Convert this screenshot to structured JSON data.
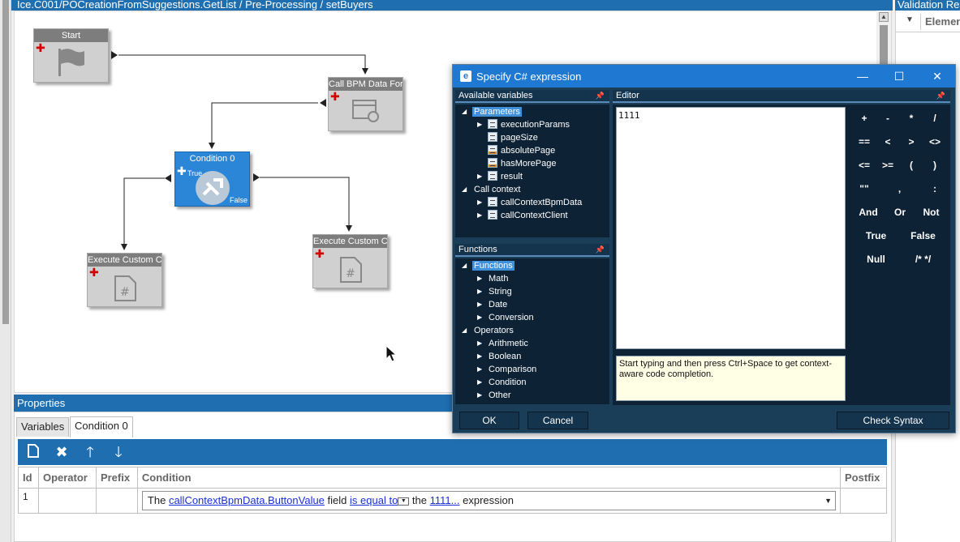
{
  "workflow": {
    "path": "Ice.C001/POCreationFromSuggestions.GetList / Pre-Processing / setBuyers",
    "nodes": {
      "start": "Start",
      "call_bpm": "Call BPM Data Form",
      "condition": "Condition 0",
      "exec1": "Execute Custom Code",
      "exec2": "Execute Custom Code"
    },
    "true_label": "True",
    "false_label": "False"
  },
  "validation": {
    "title": "Validation Results",
    "col": "Element"
  },
  "properties": {
    "title": "Properties",
    "tabs": [
      "Variables",
      "Condition 0"
    ],
    "columns": [
      "Id",
      "Operator",
      "Prefix",
      "Condition",
      "Postfix"
    ],
    "row": {
      "id": "1",
      "t1": "The",
      "field": "callContextBpmData.ButtonValue",
      "t2": "field",
      "op": "is equal to",
      "t3": "the",
      "expr": "1111...",
      "t4": "expression"
    }
  },
  "dialog": {
    "title": "Specify C# expression",
    "available_vars": "Available variables",
    "editor_label": "Editor",
    "parameters": "Parameters",
    "params": [
      "executionParams",
      "pageSize",
      "absolutePage",
      "hasMorePage",
      "result"
    ],
    "call_context": "Call context",
    "ctx": [
      "callContextBpmData",
      "callContextClient"
    ],
    "functions_hdr": "Functions",
    "functions": "Functions",
    "fn_items": [
      "Math",
      "String",
      "Date",
      "Conversion"
    ],
    "operators": "Operators",
    "op_items": [
      "Arithmetic",
      "Boolean",
      "Comparison",
      "Condition",
      "Other"
    ],
    "editor_text": "1111",
    "hint": "Start typing and then press Ctrl+Space to get context-aware code completion.",
    "keys": [
      "+",
      "-",
      "*",
      "/",
      "==",
      "<",
      ">",
      "<>",
      "<=",
      ">=",
      "(",
      ")",
      "\"\"",
      ",",
      ":",
      "And",
      "Or",
      "Not",
      "True",
      "False",
      "Null",
      "/* */"
    ],
    "ok": "OK",
    "cancel": "Cancel",
    "check": "Check Syntax"
  }
}
